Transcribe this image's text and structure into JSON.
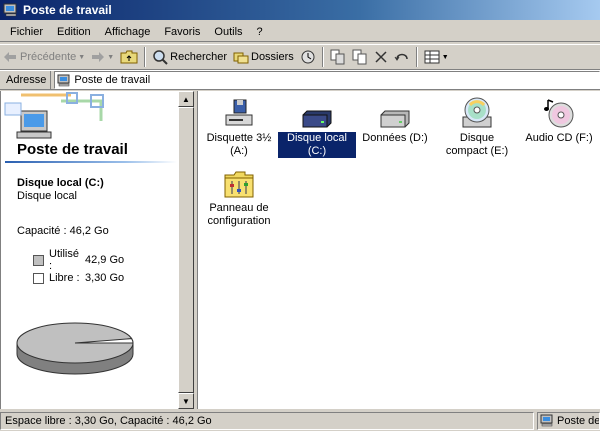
{
  "window": {
    "title": "Poste de travail"
  },
  "menu": [
    "Fichier",
    "Edition",
    "Affichage",
    "Favoris",
    "Outils",
    "?"
  ],
  "toolbar": {
    "back": "Précédente",
    "search": "Rechercher",
    "folders": "Dossiers"
  },
  "address": {
    "label": "Adresse",
    "value": "Poste de travail"
  },
  "left_pane": {
    "title": "Poste de travail",
    "drive_name": "Disque local (C:)",
    "drive_type": "Disque local",
    "capacity": "Capacité : 46,2 Go",
    "used_label": "Utilisé :",
    "used_value": "42,9 Go",
    "free_label": "Libre :",
    "free_value": "3,30 Go",
    "used_fraction": 0.929,
    "used_color": "#c0c0c0",
    "free_color": "#ffffff"
  },
  "items": [
    {
      "label": "Disquette 3½ (A:)",
      "icon": "floppy-drive-icon",
      "selected": false
    },
    {
      "label": "Disque local (C:)",
      "icon": "hard-drive-icon",
      "selected": true
    },
    {
      "label": "Données (D:)",
      "icon": "hard-drive-icon",
      "selected": false
    },
    {
      "label": "Disque compact (E:)",
      "icon": "cd-drive-icon",
      "selected": false
    },
    {
      "label": "Audio CD (F:)",
      "icon": "audio-cd-icon",
      "selected": false
    },
    {
      "label": "Panneau de configuration",
      "icon": "control-panel-icon",
      "selected": false
    }
  ],
  "status": {
    "left": "Espace libre : 3,30 Go, Capacité : 46,2 Go",
    "right": "Poste de travail"
  },
  "colors": {
    "title_bar": "#0a246a",
    "selection": "#0a246a",
    "face": "#d4d0c8"
  }
}
